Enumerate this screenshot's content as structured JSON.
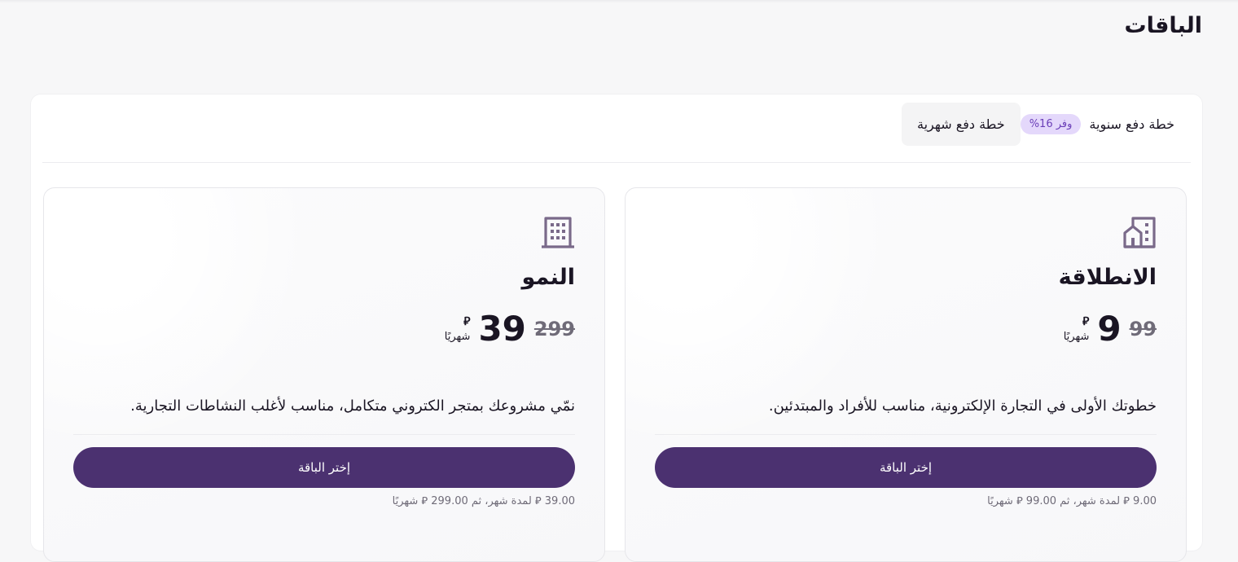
{
  "page": {
    "title": "الباقات"
  },
  "billing": {
    "monthly_label": "خطة دفع شهرية",
    "yearly_label": "خطة دفع سنوية",
    "yearly_badge": "وفر 16%",
    "selected": "monthly"
  },
  "plans": [
    {
      "icon": "home-building-icon",
      "name": "الانطلاقة",
      "old_price": "99",
      "price": "9",
      "currency": "⃁",
      "period": "شهريًا",
      "description": "خطوتك الأولى في التجارة الإلكترونية، مناسب للأفراد والمبتدئين.",
      "button_label": "إختر الباقة",
      "billing_note": "9.00 ⃁ لمدة شهر، ثم 99.00 ⃁ شهريًا"
    },
    {
      "icon": "office-building-icon",
      "name": "النمو",
      "old_price": "299",
      "price": "39",
      "currency": "⃁",
      "period": "شهريًا",
      "description": "نمّي مشروعك بمتجر الكتروني متكامل، مناسب لأغلب النشاطات التجارية.",
      "button_label": "إختر الباقة",
      "billing_note": "39.00 ⃁ لمدة شهر، ثم 299.00 ⃁ شهريًا"
    }
  ],
  "colors": {
    "primary": "#4b3170",
    "badge_bg": "#e4d8fb",
    "badge_text": "#6b3fb8",
    "icon": "#7a6a8a"
  }
}
